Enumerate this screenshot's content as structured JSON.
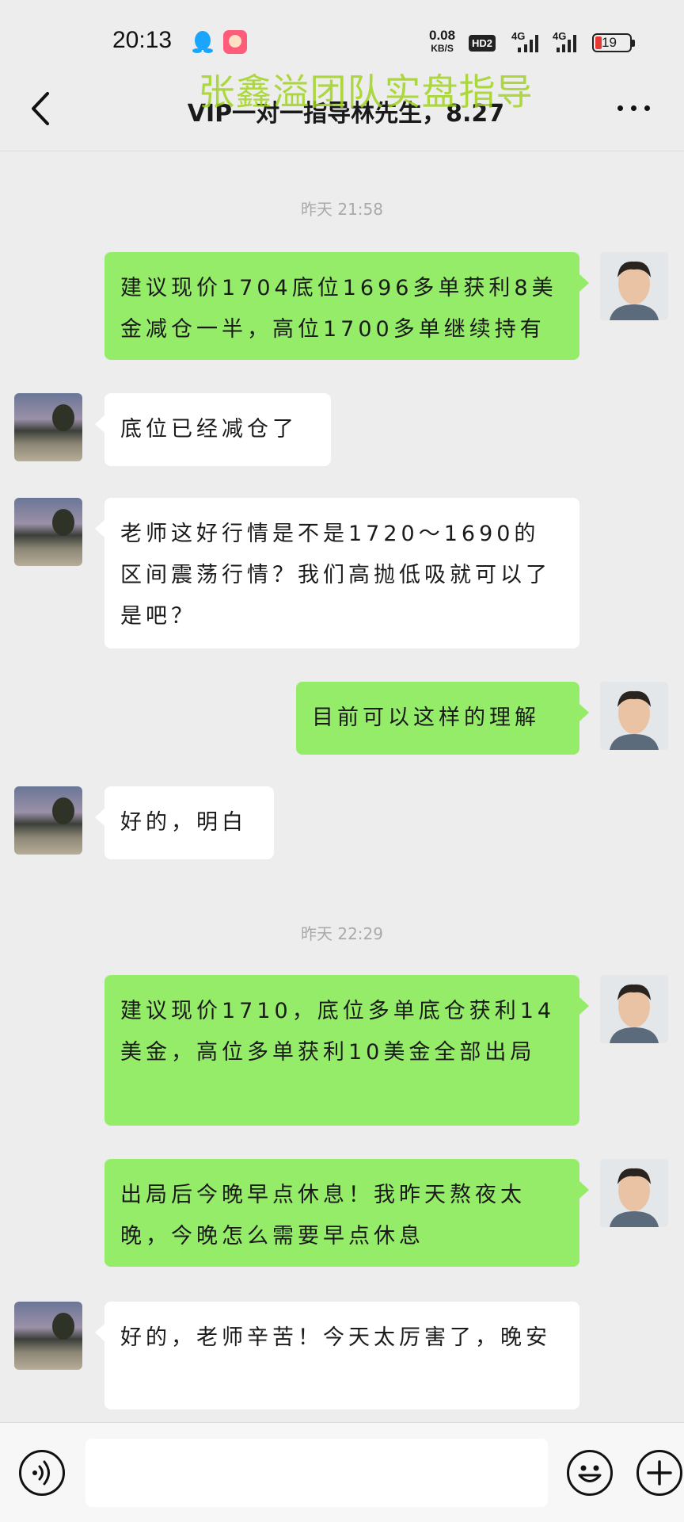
{
  "status_bar": {
    "time": "20:13",
    "net_speed": "0.08",
    "net_speed_unit": "KB/S",
    "hd_badge": "HD2",
    "signal_1_label": "4G",
    "signal_2_label": "4G",
    "battery": "19",
    "battery_level": 0.19,
    "battery_color": "#e53935"
  },
  "header": {
    "watermark": "张鑫溢团队实盘指导",
    "title": "VIP一对一指导林先生，8.27",
    "back_icon": "chevron-left-icon",
    "more_icon": "more-dots-icon"
  },
  "chat": {
    "timestamps": [
      "昨天 21:58",
      "昨天 22:29"
    ],
    "messages": [
      {
        "sender": "me",
        "text": "建议现价1704底位1696多单获利8美金减仓一半，高位1700多单继续持有"
      },
      {
        "sender": "other",
        "text": "底位已经减仓了"
      },
      {
        "sender": "other",
        "text": "老师这好行情是不是1720～1690的区间震荡行情？我们高抛低吸就可以了是吧？"
      },
      {
        "sender": "me",
        "text": "目前可以这样的理解"
      },
      {
        "sender": "other",
        "text": "好的，明白"
      },
      {
        "sender": "me",
        "text": "建议现价1710，底位多单底仓获利14美金，高位多单获利10美金全部出局"
      },
      {
        "sender": "me",
        "text": "出局后今晚早点休息！我昨天熬夜太晚，今晚怎么需要早点休息"
      },
      {
        "sender": "other",
        "text": "好的，老师辛苦！今天太厉害了，晚安"
      }
    ]
  },
  "colors": {
    "bubble_me": "#95ec69",
    "bubble_other": "#ffffff",
    "background": "#ededed",
    "watermark": "#a0d21e"
  },
  "input_bar": {
    "voice_icon": "voice-icon",
    "emoji_icon": "emoji-icon",
    "add_icon": "plus-icon"
  }
}
